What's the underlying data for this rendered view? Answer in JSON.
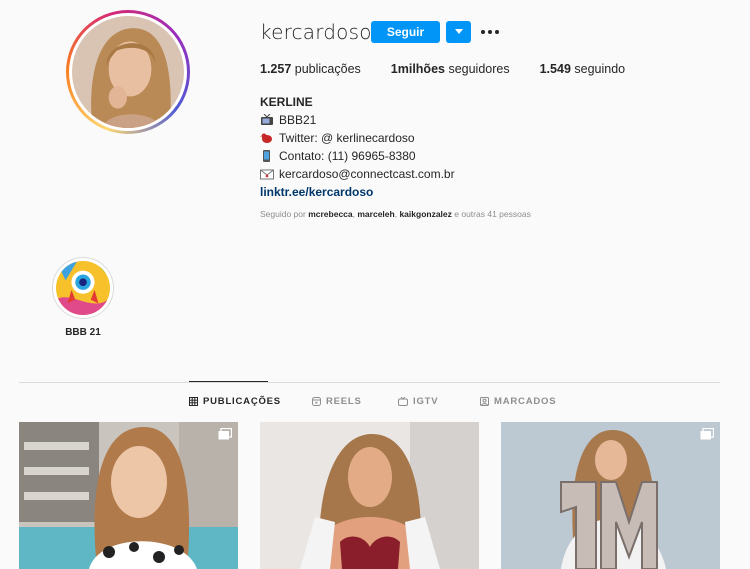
{
  "profile": {
    "username": "kercardoso",
    "follow_label": "Seguir",
    "dropdown_icon": "caret-down-icon",
    "more_icon": "more-options-icon"
  },
  "stats": {
    "posts_count": "1.257",
    "posts_label": "publicações",
    "followers_count": "1milhões",
    "followers_label": "seguidores",
    "following_count": "1.549",
    "following_label": "seguindo"
  },
  "bio": {
    "name": "KERLINE",
    "line1": "BBB21",
    "line2": "Twitter: @ kerlinecardoso",
    "line3": "Contato: (11) 96965-8380",
    "line4": "kercardoso@connectcast.com.br",
    "link": "linktr.ee/kercardoso"
  },
  "followed_by": {
    "prefix": "Seguido por",
    "user1": "mcrebecca",
    "user2": "marceleh",
    "user3": "kaikgonzalez",
    "suffix": "e outras 41 pessoas"
  },
  "highlights": [
    {
      "label": "BBB 21"
    }
  ],
  "tabs": [
    {
      "label": "PUBLICAÇÕES",
      "icon": "grid-icon",
      "active": true
    },
    {
      "label": "REELS",
      "icon": "reels-icon",
      "active": false
    },
    {
      "label": "IGTV",
      "icon": "igtv-icon",
      "active": false
    },
    {
      "label": "MARCADOS",
      "icon": "tagged-icon",
      "active": false
    }
  ],
  "colors": {
    "accent": "#0095f6",
    "background": "#fafafa",
    "link": "#00376b",
    "muted": "#8e8e8e"
  }
}
